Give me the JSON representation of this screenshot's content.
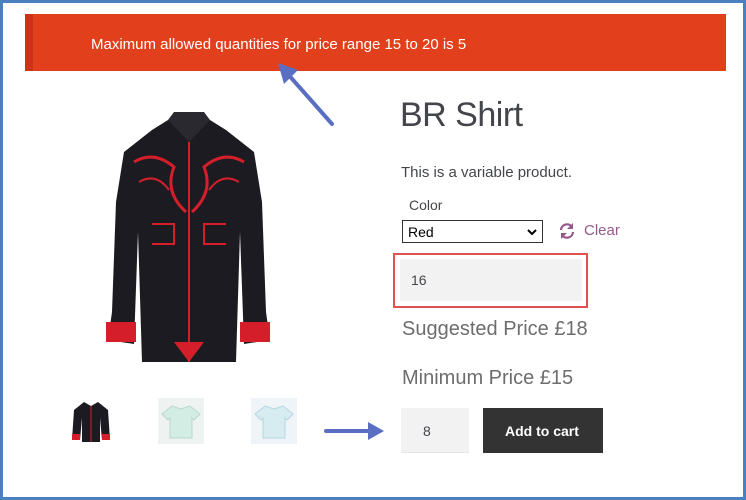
{
  "notice": {
    "message": "Maximum allowed quantities for price range 15 to 20 is 5",
    "color": "#e2401c"
  },
  "product": {
    "title": "BR Shirt",
    "description": "This is a variable product.",
    "attribute_label": "Color",
    "selected_color": "Red",
    "clear_label": "Clear",
    "price_value": "16",
    "suggested_price": "Suggested Price £18",
    "minimum_price": "Minimum Price £15",
    "quantity": "8",
    "add_to_cart_label": "Add to cart"
  },
  "gallery": {
    "thumbnails": [
      "black-red-shirt",
      "mint-shirt",
      "light-blue-shirt"
    ]
  },
  "colors": {
    "accent_link": "#96588a",
    "button": "#333333",
    "highlight_box": "#e0524f",
    "annotation_arrow": "#5b6fc2"
  }
}
